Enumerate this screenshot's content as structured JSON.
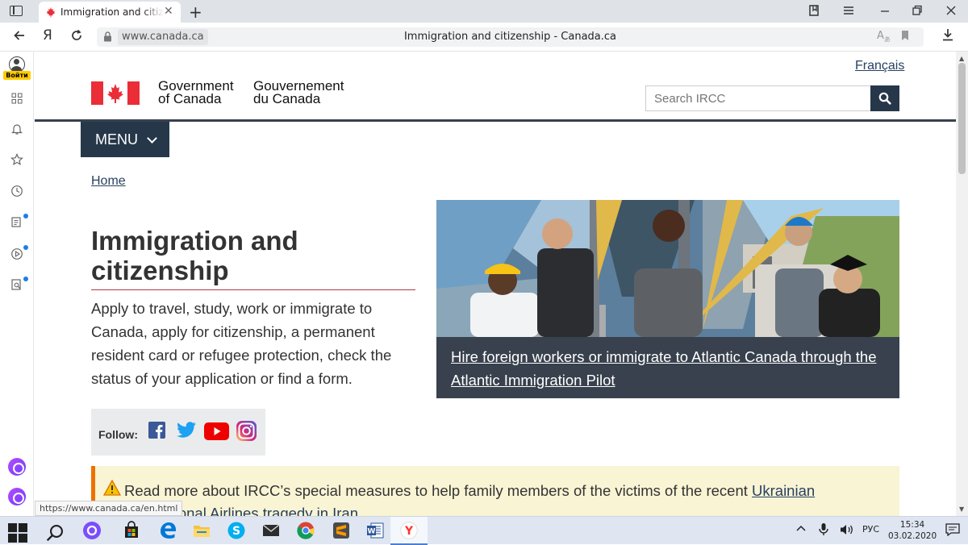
{
  "browser": {
    "tab_title": "Immigration and citizenship - Canada.ca",
    "domain_chip": "www.canada.ca",
    "page_title": "Immigration and citizenship - Canada.ca",
    "login_label": "Войти",
    "status_url": "https://www.canada.ca/en.html"
  },
  "header": {
    "language_link": "Français",
    "signature_en": "Government of Canada",
    "signature_fr": "Gouvernement du Canada",
    "search_placeholder": "Search IRCC"
  },
  "menu": {
    "label": "MENU"
  },
  "breadcrumb": {
    "home": "Home"
  },
  "main": {
    "title": "Immigration and citizenship",
    "intro": "Apply to travel, study, work or immigrate to Canada, apply for citizenship, a permanent resident card or refugee protection, check the status of your application or find a form.",
    "follow_label": "Follow:",
    "social": [
      "facebook",
      "twitter",
      "youtube",
      "instagram"
    ]
  },
  "hero": {
    "link_text": "Hire foreign workers or immigrate to Atlantic Canada through the Atlantic Immigration Pilot"
  },
  "alert": {
    "text_before": "Read more about IRCC’s special measures to help family members of the victims of the recent ",
    "link_text": "Ukrainian International Airlines tragedy in Iran",
    "text_after": "."
  },
  "taskbar": {
    "language": "РУС",
    "time": "15:34",
    "date": "03.02.2020"
  },
  "colors": {
    "canada_red": "#eb2d37",
    "dark_navy": "#26374a",
    "link_blue": "#284162",
    "alert_bg": "#f9f4d4"
  }
}
